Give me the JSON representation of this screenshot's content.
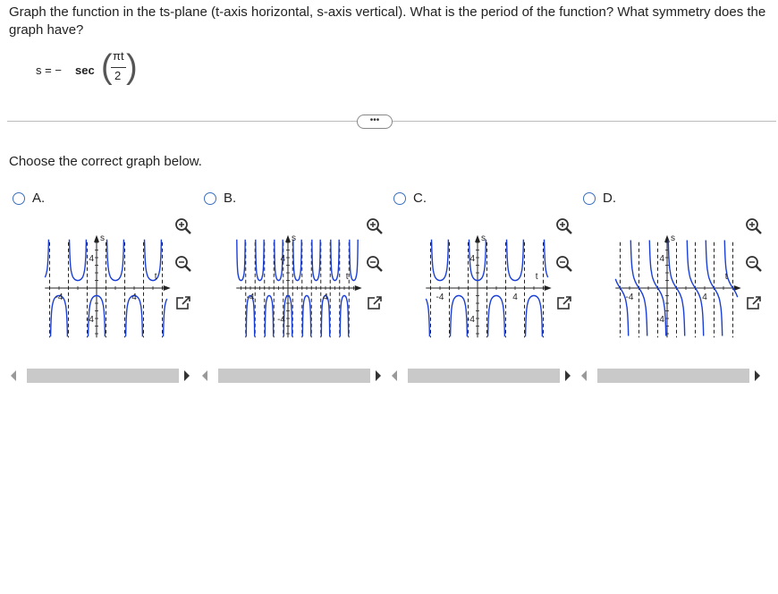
{
  "question": {
    "text": "Graph the function in the ts-plane (t-axis horizontal, s-axis vertical). What is the period of the function? What symmetry does the graph have?"
  },
  "formula": {
    "lhs": "s = −",
    "func": "sec",
    "numerator": "πt",
    "denominator": "2"
  },
  "more_button_label": "•••",
  "prompt": "Choose the correct graph below.",
  "options": [
    {
      "letter": "A.",
      "graph": {
        "xlabel": "t",
        "ylabel": "s",
        "tick_pos": "4",
        "tick_neg": "-4",
        "ytick_pos": "4",
        "ytick_neg": "-4",
        "sign": -1,
        "period": 4
      }
    },
    {
      "letter": "B.",
      "graph": {
        "xlabel": "t",
        "ylabel": "s",
        "tick_pos": "4",
        "tick_neg": "-4",
        "ytick_pos": "4",
        "ytick_neg": "-4",
        "sign": -1,
        "period": 2
      }
    },
    {
      "letter": "C.",
      "graph": {
        "xlabel": "t",
        "ylabel": "s",
        "tick_pos": "4",
        "tick_neg": "-4",
        "ytick_pos": "4",
        "ytick_neg": "-4",
        "sign": 1,
        "period": 4
      }
    },
    {
      "letter": "D.",
      "graph": {
        "xlabel": "t",
        "ylabel": "s",
        "tick_pos": "4",
        "tick_neg": "-4",
        "ytick_pos": "4",
        "ytick_neg": "-4",
        "sign": -1,
        "period": 4,
        "variant": "tan-like"
      }
    }
  ],
  "tools": [
    "zoom-in-icon",
    "zoom-out-icon",
    "expand-icon"
  ],
  "colors": {
    "curve": "#1a3fd8",
    "asymptote": "#222222",
    "radio": "#3b6fbf"
  }
}
